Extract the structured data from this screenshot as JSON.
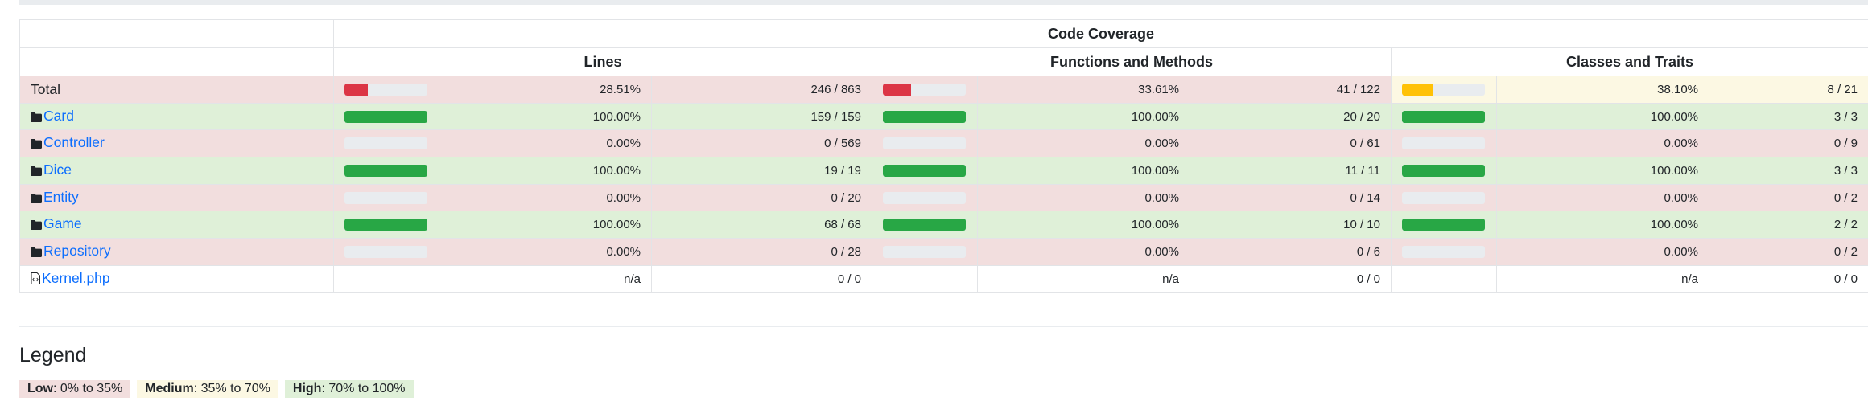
{
  "header": {
    "coverage_title": "Code Coverage",
    "lines": "Lines",
    "functions": "Functions and Methods",
    "classes": "Classes and Traits"
  },
  "rows": [
    {
      "name": "Total",
      "kind": "total",
      "status": "danger",
      "lines_pct": "28.51%",
      "lines_ratio": "246 / 863",
      "lines_fill": 28.51,
      "lines_level": "low",
      "func_pct": "33.61%",
      "func_ratio": "41 / 122",
      "func_fill": 33.61,
      "func_level": "low",
      "cls_pct": "38.10%",
      "cls_ratio": "8 / 21",
      "cls_fill": 38.1,
      "cls_level": "medium"
    },
    {
      "name": "Card",
      "kind": "folder",
      "status": "success",
      "lines_pct": "100.00%",
      "lines_ratio": "159 / 159",
      "lines_fill": 100,
      "lines_level": "high",
      "func_pct": "100.00%",
      "func_ratio": "20 / 20",
      "func_fill": 100,
      "func_level": "high",
      "cls_pct": "100.00%",
      "cls_ratio": "3 / 3",
      "cls_fill": 100,
      "cls_level": "high"
    },
    {
      "name": "Controller",
      "kind": "folder",
      "status": "danger",
      "lines_pct": "0.00%",
      "lines_ratio": "0 / 569",
      "lines_fill": 0,
      "lines_level": "low",
      "func_pct": "0.00%",
      "func_ratio": "0 / 61",
      "func_fill": 0,
      "func_level": "low",
      "cls_pct": "0.00%",
      "cls_ratio": "0 / 9",
      "cls_fill": 0,
      "cls_level": "low"
    },
    {
      "name": "Dice",
      "kind": "folder",
      "status": "success",
      "lines_pct": "100.00%",
      "lines_ratio": "19 / 19",
      "lines_fill": 100,
      "lines_level": "high",
      "func_pct": "100.00%",
      "func_ratio": "11 / 11",
      "func_fill": 100,
      "func_level": "high",
      "cls_pct": "100.00%",
      "cls_ratio": "3 / 3",
      "cls_fill": 100,
      "cls_level": "high"
    },
    {
      "name": "Entity",
      "kind": "folder",
      "status": "danger",
      "lines_pct": "0.00%",
      "lines_ratio": "0 / 20",
      "lines_fill": 0,
      "lines_level": "low",
      "func_pct": "0.00%",
      "func_ratio": "0 / 14",
      "func_fill": 0,
      "func_level": "low",
      "cls_pct": "0.00%",
      "cls_ratio": "0 / 2",
      "cls_fill": 0,
      "cls_level": "low"
    },
    {
      "name": "Game",
      "kind": "folder",
      "status": "success",
      "lines_pct": "100.00%",
      "lines_ratio": "68 / 68",
      "lines_fill": 100,
      "lines_level": "high",
      "func_pct": "100.00%",
      "func_ratio": "10 / 10",
      "func_fill": 100,
      "func_level": "high",
      "cls_pct": "100.00%",
      "cls_ratio": "2 / 2",
      "cls_fill": 100,
      "cls_level": "high"
    },
    {
      "name": "Repository",
      "kind": "folder",
      "status": "danger",
      "lines_pct": "0.00%",
      "lines_ratio": "0 / 28",
      "lines_fill": 0,
      "lines_level": "low",
      "func_pct": "0.00%",
      "func_ratio": "0 / 6",
      "func_fill": 0,
      "func_level": "low",
      "cls_pct": "0.00%",
      "cls_ratio": "0 / 2",
      "cls_fill": 0,
      "cls_level": "low"
    },
    {
      "name": "Kernel.php",
      "kind": "file",
      "status": "none",
      "lines_pct": "n/a",
      "lines_ratio": "0 / 0",
      "lines_fill": null,
      "lines_level": "",
      "func_pct": "n/a",
      "func_ratio": "0 / 0",
      "func_fill": null,
      "func_level": "",
      "cls_pct": "n/a",
      "cls_ratio": "0 / 0",
      "cls_fill": null,
      "cls_level": ""
    }
  ],
  "legend": {
    "title": "Legend",
    "low_label": "Low",
    "low_range": ": 0% to 35%",
    "medium_label": "Medium",
    "medium_range": ": 35% to 70%",
    "high_label": "High",
    "high_range": ": 70% to 100%"
  },
  "colors": {
    "low": "#dc3545",
    "medium": "#ffc107",
    "high": "#28a745",
    "row_danger": "#f2dede",
    "row_warning": "#fcf8e3",
    "row_success": "#dff0d8",
    "link": "#0d6efd"
  },
  "icons": {
    "folder": "folder-icon",
    "file": "file-code-icon"
  }
}
